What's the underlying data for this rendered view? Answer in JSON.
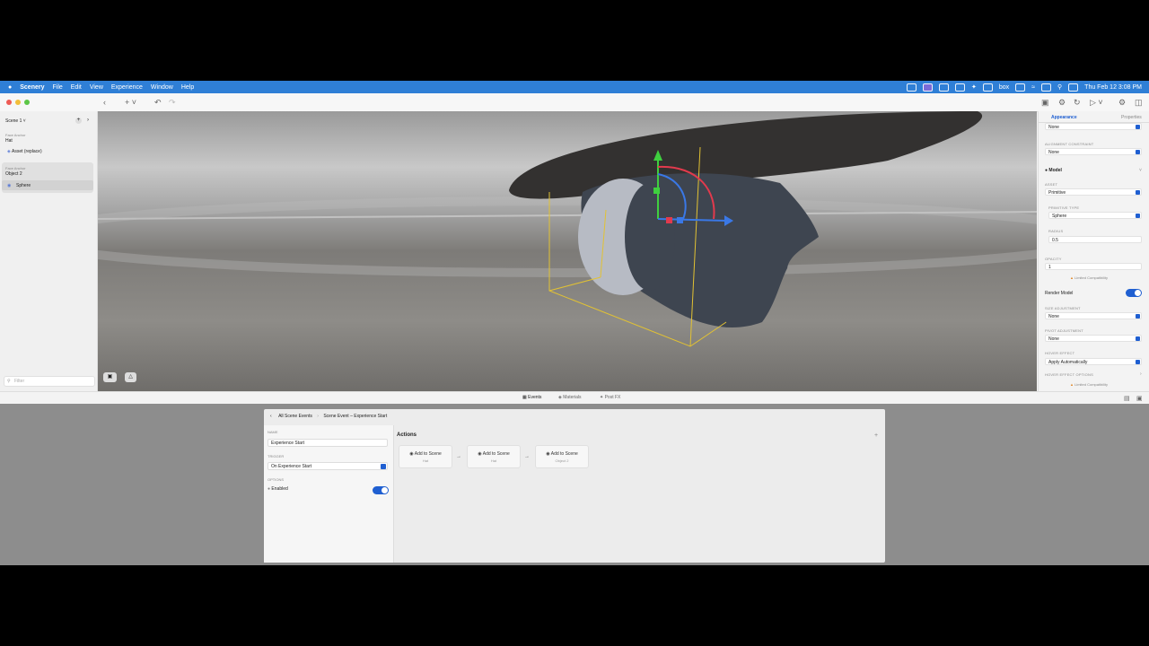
{
  "menubar": {
    "app_name": "Scenery",
    "items": [
      "File",
      "Edit",
      "View",
      "Experience",
      "Window",
      "Help"
    ],
    "right_text": "box",
    "clock": "Thu Feb 12  3:08 PM"
  },
  "sidebar": {
    "scene_label": "Scene 1",
    "group1_caption": "Face Anchor",
    "group1_title": "Hat",
    "group1_child": "Asset (replace)",
    "group2_caption": "Face Anchor",
    "group2_title": "Object 2",
    "group2_child": "Sphere",
    "filter_placeholder": "Filter"
  },
  "inspector": {
    "tabs": [
      "Appearance",
      "Properties"
    ],
    "top_value": "None",
    "alignment_constraint_label": "ALIGNMENT CONSTRAINT",
    "alignment_constraint_value": "None",
    "model_section": "Model",
    "asset_label": "ASSET",
    "asset_value": "Primitive",
    "primitive_type_label": "PRIMITIVE TYPE",
    "primitive_type_value": "Sphere",
    "radius_label": "RADIUS",
    "radius_value": "0.5",
    "opacity_label": "OPACITY",
    "opacity_value": "1",
    "limited_compat": "Limited Compatibility",
    "render_model_label": "Render Model",
    "size_adjustment_label": "SIZE ADJUSTMENT",
    "size_adjustment_value": "None",
    "pivot_adjustment_label": "PIVOT ADJUSTMENT",
    "pivot_adjustment_value": "None",
    "hover_effect_label": "HOVER EFFECT",
    "hover_effect_value": "Apply Automatically",
    "hover_effect_options_label": "HOVER EFFECT OPTIONS",
    "limited_compat_2": "Limited Compatibility"
  },
  "bottom_tabs": [
    "Events",
    "Materials",
    "Post FX"
  ],
  "events": {
    "breadcrumb_root": "All Scene Events",
    "breadcrumb_current": "Scene Event – Experience Start",
    "name_label": "NAME",
    "name_value": "Experience Start",
    "trigger_label": "TRIGGER",
    "trigger_value": "On Experience Start",
    "options_label": "OPTIONS",
    "enabled_label": "Enabled",
    "actions_title": "Actions",
    "actions": [
      {
        "title": "Add to Scene",
        "target": "Hat"
      },
      {
        "title": "Add to Scene",
        "target": "Hat"
      },
      {
        "title": "Add to Scene",
        "target": "Object 2"
      }
    ]
  }
}
